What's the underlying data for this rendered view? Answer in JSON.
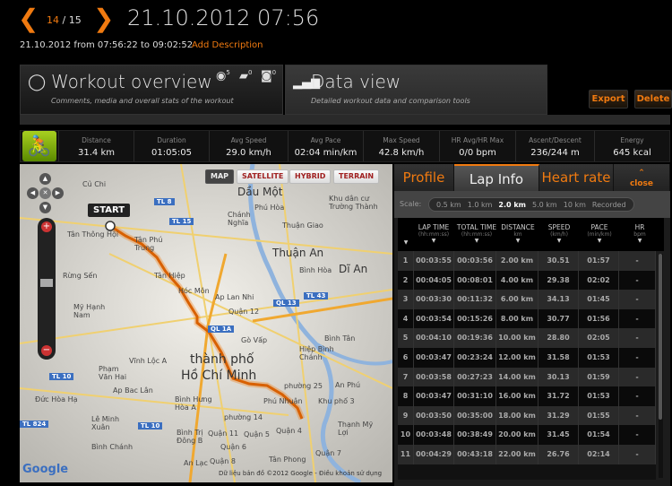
{
  "header": {
    "prev_icon": "chevron-left",
    "next_icon": "chevron-right",
    "current": "14",
    "total": "15",
    "title": "21.10.2012 07:56",
    "subtitle": "21.10.2012 from 07:56:22 to 09:02:52",
    "add_description": "Add Description"
  },
  "tabs": [
    {
      "title": "Workout overview",
      "desc": "Comments, media and overall stats of the workout",
      "icon": "loop-icon",
      "badges": [
        {
          "icon": "eye-icon",
          "count": "5"
        },
        {
          "icon": "comment-icon",
          "count": "0"
        },
        {
          "icon": "camera-icon",
          "count": "0"
        }
      ]
    },
    {
      "title": "Data view",
      "desc": "Detailed workout data and comparison tools",
      "icon": "bar-chart-icon"
    }
  ],
  "actions": {
    "export": "Export",
    "delete": "Delete"
  },
  "stats": [
    {
      "label": "Distance",
      "value": "31.4 km"
    },
    {
      "label": "Duration",
      "value": "01:05:05"
    },
    {
      "label": "Avg Speed",
      "value": "29.0 km/h"
    },
    {
      "label": "Avg Pace",
      "value": "02:04 min/km"
    },
    {
      "label": "Max Speed",
      "value": "42.8 km/h"
    },
    {
      "label": "HR Avg/HR Max",
      "value": "0/0 bpm"
    },
    {
      "label": "Ascent/Descent",
      "value": "236/244 m"
    },
    {
      "label": "Energy",
      "value": "645 kcal"
    }
  ],
  "sport_icon": "cycling-icon",
  "map": {
    "types": [
      "MAP",
      "SATELLITE",
      "HYBRID",
      "TERRAIN"
    ],
    "selected_type": "MAP",
    "start_label": "START",
    "places": [
      "Củ Chi",
      "Dầu Một",
      "Phú Hòa",
      "Chánh Nghĩa",
      "Thuận Giao",
      "Khu dân cư Trường Thành",
      "Tân Thông Hội",
      "Tân Phú Trung",
      "Thuận An",
      "Bình Hòa",
      "Dĩ An",
      "Rừng Sến",
      "Tân Hiệp",
      "Hóc Môn",
      "Ap Lan Nhi",
      "Mỹ Hạnh Nam",
      "Quận 12",
      "Gò Vấp",
      "Bình Tân",
      "Hiệp Bình Chánh",
      "Vĩnh Lộc A",
      "Phạm Văn Hai",
      "thành phố",
      "Hồ Chí Minh",
      "Ap Bac Lân",
      "Đức Hòa Hạ",
      "Bình Hưng Hòa A",
      "phường 25",
      "Phú Nhuận",
      "Khu phố 3",
      "An Phú",
      "Lê Minh Xuân",
      "phường 14",
      "Quận 4",
      "Quận 11",
      "Quận 5",
      "Quận 6",
      "Quận 8",
      "Quận 7",
      "Bình Chánh",
      "Tân Phong",
      "An Lạc",
      "Thạnh Mỹ Lợi",
      "Bình Trị Đông B"
    ],
    "roads": [
      "TL 8",
      "TL 15",
      "QL 13",
      "TL 43",
      "QL 1A",
      "TL 10",
      "TL 824",
      "TL 10"
    ],
    "attribution": "Dữ liệu bản đồ ©2012 Google - Điều khoản sử dụng",
    "logo": "Google"
  },
  "panel": {
    "tabs": [
      "Profile",
      "Lap Info",
      "Heart rate"
    ],
    "active_tab": "Lap Info",
    "close": "close",
    "scale_label": "Scale:",
    "scales": [
      "0.5 km",
      "1.0 km",
      "2.0 km",
      "5.0 km",
      "10 km",
      "Recorded"
    ],
    "selected_scale": "2.0 km",
    "columns": [
      {
        "name": "LAP TIME",
        "unit": "(hh:mm:ss)"
      },
      {
        "name": "TOTAL TIME",
        "unit": "(hh:mm:ss)"
      },
      {
        "name": "DISTANCE",
        "unit": "km"
      },
      {
        "name": "SPEED",
        "unit": "(km/h)"
      },
      {
        "name": "PACE",
        "unit": "(min/km)"
      },
      {
        "name": "HR",
        "unit": "bpm"
      }
    ],
    "rows": [
      [
        "1",
        "00:03:55",
        "00:03:56",
        "2.00 km",
        "30.51",
        "01:57",
        "-"
      ],
      [
        "2",
        "00:04:05",
        "00:08:01",
        "4.00 km",
        "29.38",
        "02:02",
        "-"
      ],
      [
        "3",
        "00:03:30",
        "00:11:32",
        "6.00 km",
        "34.13",
        "01:45",
        "-"
      ],
      [
        "4",
        "00:03:54",
        "00:15:26",
        "8.00 km",
        "30.77",
        "01:56",
        "-"
      ],
      [
        "5",
        "00:04:10",
        "00:19:36",
        "10.00 km",
        "28.80",
        "02:05",
        "-"
      ],
      [
        "6",
        "00:03:47",
        "00:23:24",
        "12.00 km",
        "31.58",
        "01:53",
        "-"
      ],
      [
        "7",
        "00:03:58",
        "00:27:23",
        "14.00 km",
        "30.13",
        "01:59",
        "-"
      ],
      [
        "8",
        "00:03:47",
        "00:31:10",
        "16.00 km",
        "31.72",
        "01:53",
        "-"
      ],
      [
        "9",
        "00:03:50",
        "00:35:00",
        "18.00 km",
        "31.29",
        "01:55",
        "-"
      ],
      [
        "10",
        "00:03:48",
        "00:38:49",
        "20.00 km",
        "31.45",
        "01:54",
        "-"
      ],
      [
        "11",
        "00:04:29",
        "00:43:18",
        "22.00 km",
        "26.76",
        "02:14",
        "-"
      ]
    ]
  },
  "colors": {
    "accent": "#f07a10",
    "sport": "#8bc000",
    "route": "#f07a10"
  }
}
